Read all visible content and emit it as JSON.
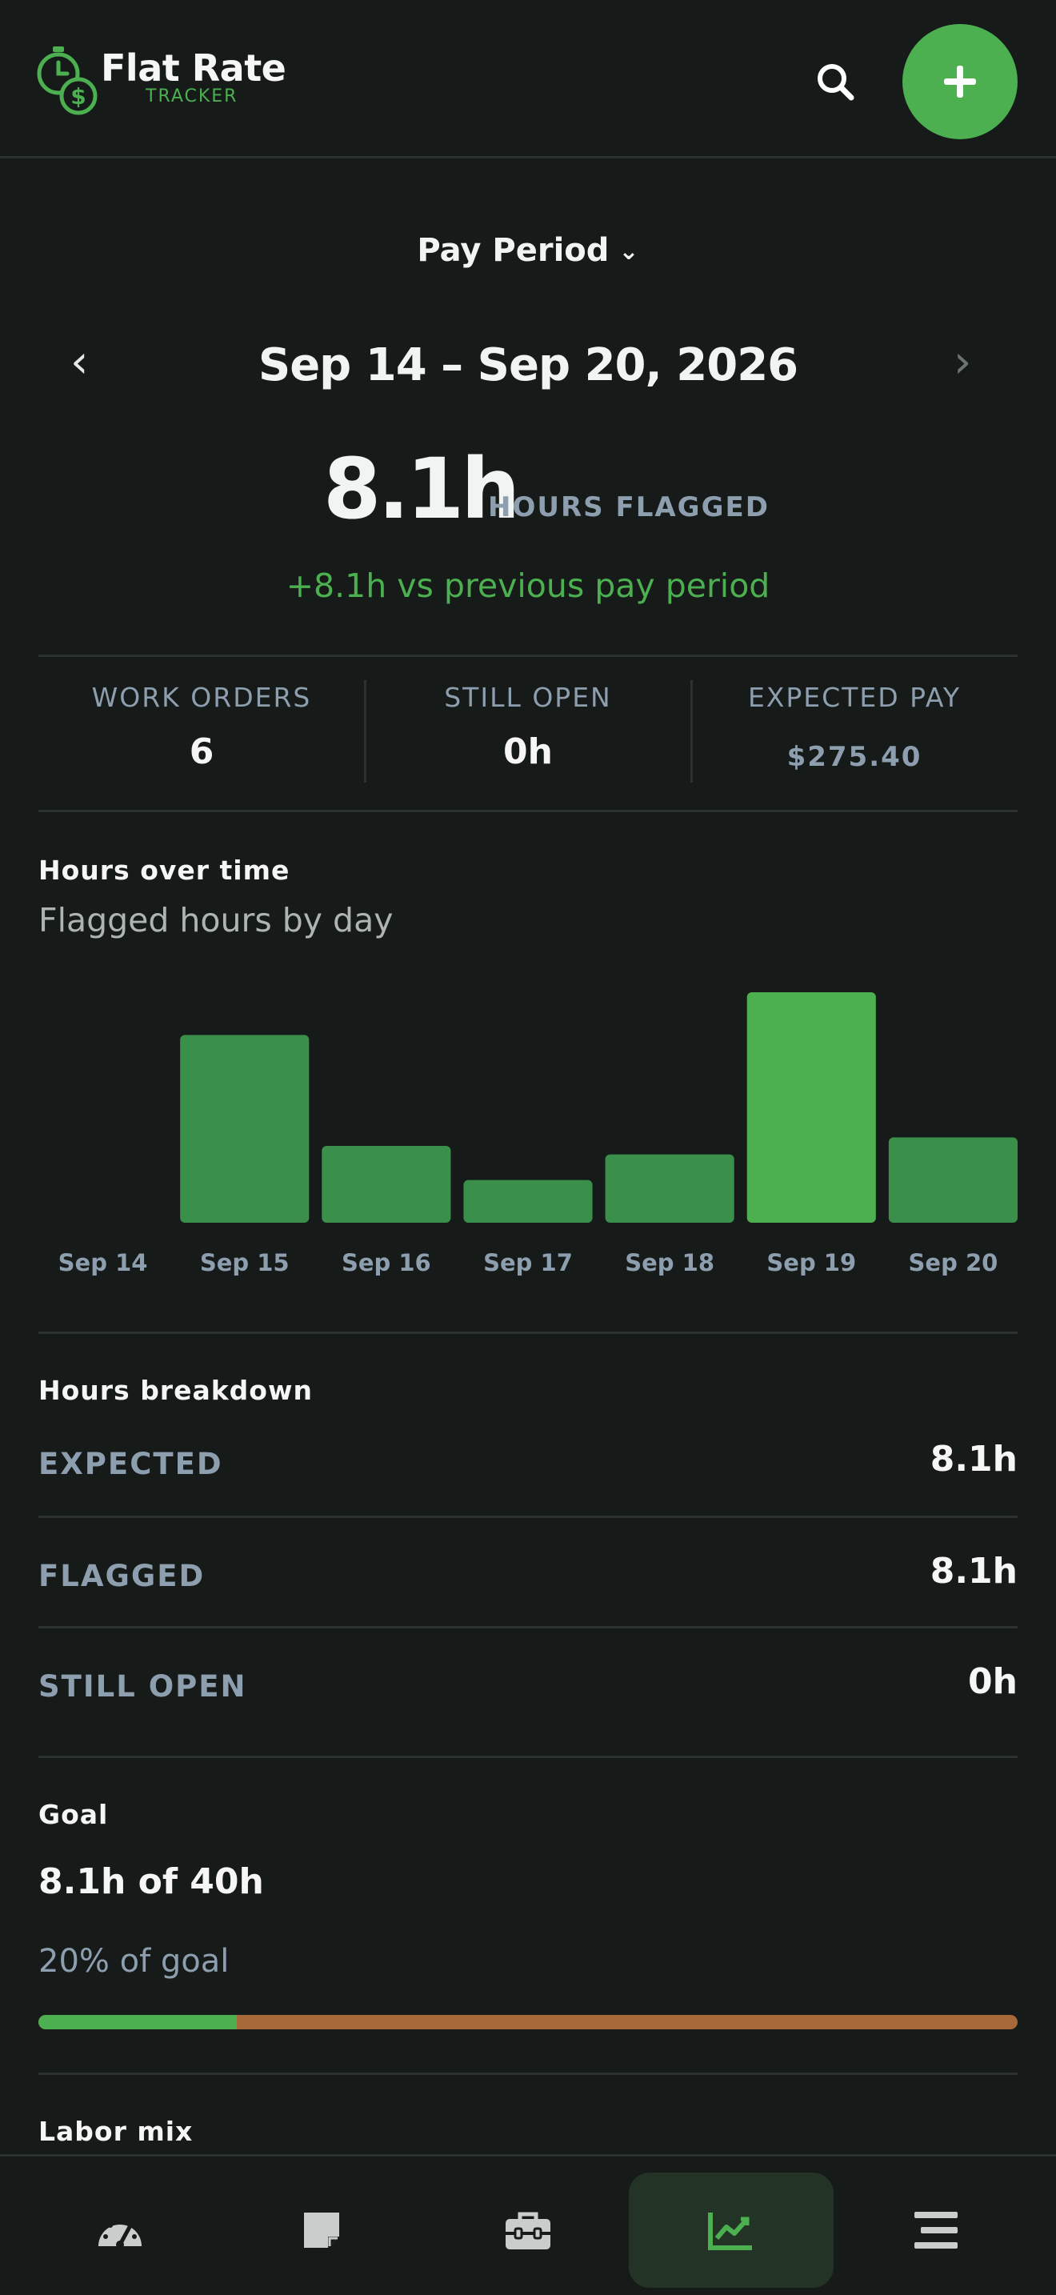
{
  "header": {
    "brand_title": "Flat Rate",
    "brand_subtitle": "TRACKER",
    "logo_icon": "stopwatch-dollar-icon",
    "search_icon": "search-icon",
    "add_icon": "plus-icon",
    "accent_color": "#4caf50"
  },
  "period": {
    "selector_label": "Pay Period",
    "selector_chevron": "⌄",
    "prev_arrow": "‹",
    "next_arrow": "›",
    "date_range": "Sep 14 – Sep 20, 2026"
  },
  "summary": {
    "hours_value": "8.1h",
    "hours_label": "HOURS FLAGGED",
    "comparison": "+8.1h vs previous pay period"
  },
  "kpis": [
    {
      "label": "WORK ORDERS",
      "value": "6"
    },
    {
      "label": "STILL OPEN",
      "value": "0h"
    },
    {
      "label": "EXPECTED PAY",
      "value": "$275.40"
    }
  ],
  "hours_chart": {
    "title": "Hours over time",
    "subtitle": "Flagged hours by day"
  },
  "chart_data": {
    "type": "bar",
    "categories": [
      "Sep 14",
      "Sep 15",
      "Sep 16",
      "Sep 17",
      "Sep 18",
      "Sep 19",
      "Sep 20"
    ],
    "values": [
      0,
      2.2,
      0.9,
      0.5,
      0.8,
      2.7,
      1.0
    ],
    "highlight_index": 5,
    "bar_color": "#3a8f4a",
    "highlight_color": "#4caf50",
    "ylim": [
      0,
      2.7
    ],
    "grid": false
  },
  "breakdown": {
    "title": "Hours breakdown",
    "rows": [
      {
        "label": "EXPECTED",
        "value": "8.1h"
      },
      {
        "label": "FLAGGED",
        "value": "8.1h"
      },
      {
        "label": "STILL OPEN",
        "value": "0h"
      }
    ]
  },
  "goal": {
    "title": "Goal",
    "value_text": "8.1h of 40h",
    "percent_text": "20% of goal",
    "progress_fraction": 0.2025,
    "fill_color": "#4caf50",
    "track_color": "#a7693a"
  },
  "labor_mix": {
    "title": "Labor mix"
  },
  "bottom_nav": {
    "items": [
      {
        "icon": "speedometer-icon",
        "active": false
      },
      {
        "icon": "note-icon",
        "active": false
      },
      {
        "icon": "toolbox-icon",
        "active": false
      },
      {
        "icon": "trend-chart-icon",
        "active": true
      },
      {
        "icon": "menu-icon",
        "active": false
      }
    ]
  }
}
